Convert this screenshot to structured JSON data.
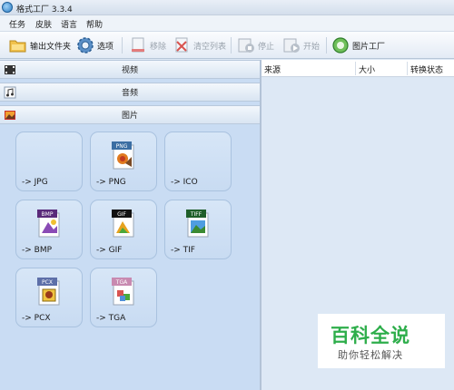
{
  "window": {
    "title": "格式工厂 3.3.4"
  },
  "menu": {
    "items": [
      "任务",
      "皮肤",
      "语言",
      "帮助"
    ]
  },
  "toolbar": {
    "output_folder": "输出文件夹",
    "options": "选项",
    "remove": "移除",
    "clear_list": "清空列表",
    "stop": "停止",
    "start": "开始",
    "picture_factory": "图片工厂"
  },
  "sections": {
    "video": "视频",
    "audio": "音频",
    "picture": "图片"
  },
  "formats": [
    {
      "label": "-> JPG",
      "badge": ""
    },
    {
      "label": "-> PNG",
      "badge": "PNG"
    },
    {
      "label": "-> ICO",
      "badge": ""
    },
    {
      "label": "-> BMP",
      "badge": "BMP"
    },
    {
      "label": "-> GIF",
      "badge": "GIF"
    },
    {
      "label": "-> TIF",
      "badge": "TIFF"
    },
    {
      "label": "-> PCX",
      "badge": "PCX"
    },
    {
      "label": "-> TGA",
      "badge": "TGA"
    }
  ],
  "task_list": {
    "columns": [
      "来源",
      "大小",
      "转换状态"
    ]
  },
  "watermark": {
    "title": "百科全说",
    "subtitle": "助你轻松解决"
  },
  "colors": {
    "accent": "#2b7cc4",
    "watermark_green": "#2eae4b",
    "panel": "#c9dcf3"
  }
}
